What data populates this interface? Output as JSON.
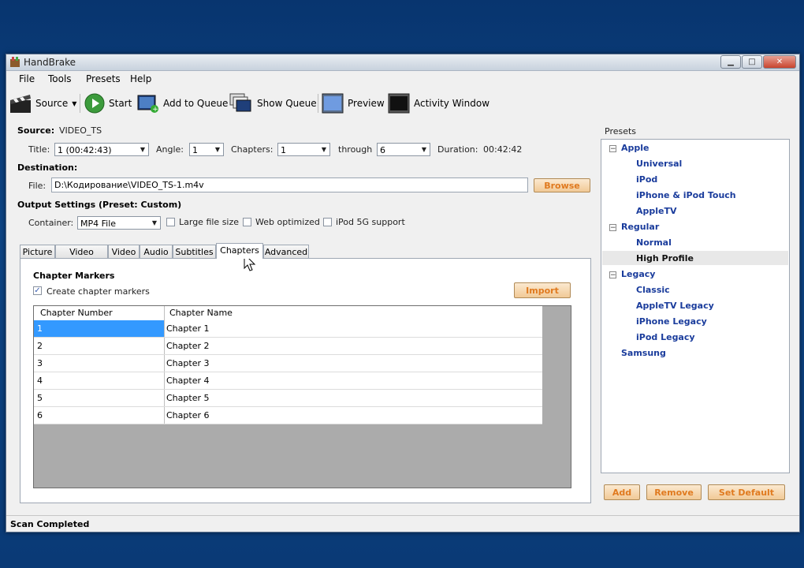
{
  "window": {
    "title": "HandBrake"
  },
  "menu": [
    "File",
    "Tools",
    "Presets",
    "Help"
  ],
  "toolbar": {
    "source": "Source",
    "start": "Start",
    "add_to_queue": "Add to Queue",
    "show_queue": "Show Queue",
    "preview": "Preview",
    "activity_window": "Activity Window"
  },
  "source": {
    "label": "Source:",
    "value": "VIDEO_TS",
    "title_label": "Title:",
    "title_value": "1 (00:42:43)",
    "angle_label": "Angle:",
    "angle_value": "1",
    "chapters_label": "Chapters:",
    "chapters_from": "1",
    "through_label": "through",
    "chapters_to": "6",
    "duration_label": "Duration:",
    "duration_value": "00:42:42"
  },
  "destination": {
    "label": "Destination:",
    "file_label": "File:",
    "file_value": "D:\\Кодирование\\VIDEO_TS-1.m4v",
    "browse": "Browse"
  },
  "output": {
    "label": "Output Settings (Preset: Custom)",
    "container_label": "Container:",
    "container_value": "MP4 File",
    "large_file": "Large file size",
    "web_optimized": "Web optimized",
    "ipod_support": "iPod 5G support"
  },
  "tabs": [
    "Picture",
    "Video Filters",
    "Video",
    "Audio",
    "Subtitles",
    "Chapters",
    "Advanced"
  ],
  "active_tab": "Chapters",
  "chapters": {
    "heading": "Chapter Markers",
    "create_label": "Create chapter markers",
    "create_checked": true,
    "import": "Import",
    "columns": [
      "Chapter Number",
      "Chapter Name"
    ],
    "rows": [
      {
        "number": "1",
        "name": "Chapter 1"
      },
      {
        "number": "2",
        "name": "Chapter 2"
      },
      {
        "number": "3",
        "name": "Chapter 3"
      },
      {
        "number": "4",
        "name": "Chapter 4"
      },
      {
        "number": "5",
        "name": "Chapter 5"
      },
      {
        "number": "6",
        "name": "Chapter 6"
      }
    ]
  },
  "presets": {
    "label": "Presets",
    "apple": {
      "name": "Apple",
      "items": [
        "Universal",
        "iPod",
        "iPhone & iPod Touch",
        "AppleTV"
      ]
    },
    "regular": {
      "name": "Regular",
      "items": [
        "Normal",
        "High Profile"
      ]
    },
    "legacy": {
      "name": "Legacy",
      "items": [
        "Classic",
        "AppleTV Legacy",
        "iPhone Legacy",
        "iPod Legacy"
      ]
    },
    "samsung": "Samsung",
    "add": "Add",
    "remove": "Remove",
    "set_default": "Set Default"
  },
  "status": "Scan Completed",
  "colors": {
    "accent_orange": "#e07a1f",
    "preset_blue": "#1a3c9c",
    "selection": "#3399ff"
  }
}
